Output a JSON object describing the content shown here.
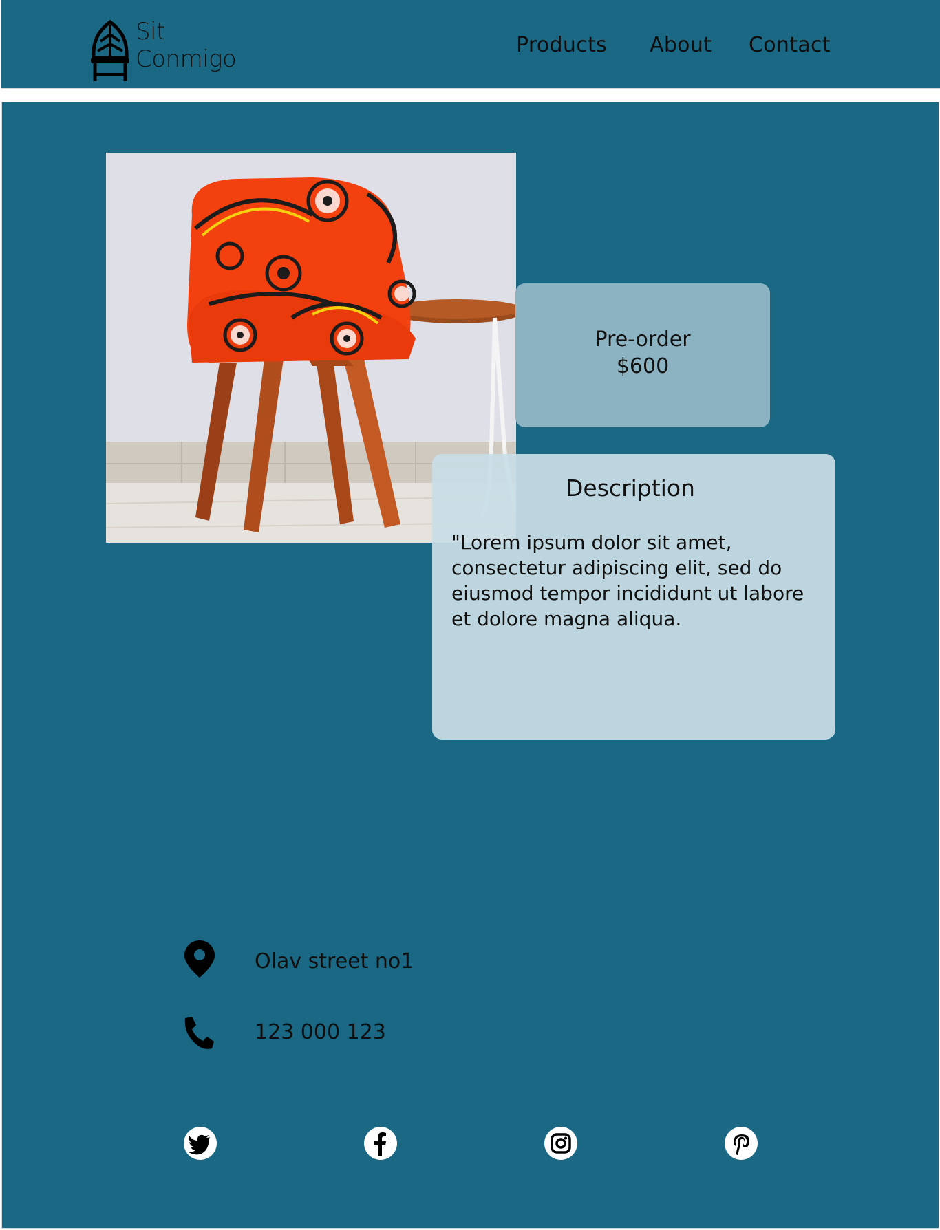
{
  "header": {
    "brand_line1": "Sit",
    "brand_line2": "Conmigo",
    "nav": [
      "Products",
      "About",
      "Contact"
    ]
  },
  "product": {
    "preorder_label": "Pre-order",
    "price": "$600",
    "description_title": "Description",
    "description_text": "\"Lorem ipsum dolor sit amet, consectetur adipiscing elit, sed do eiusmod tempor incididunt ut labore et dolore magna aliqua."
  },
  "contact": {
    "address": "Olav street no1",
    "phone": "123 000 123"
  },
  "social": [
    "twitter-icon",
    "facebook-icon",
    "instagram-icon",
    "pinterest-icon"
  ],
  "colors": {
    "background": "#1b6884",
    "preorder_box": "#8cb3c1",
    "description_box": "#c8dee5",
    "chair_fabric": "#f2400f"
  }
}
